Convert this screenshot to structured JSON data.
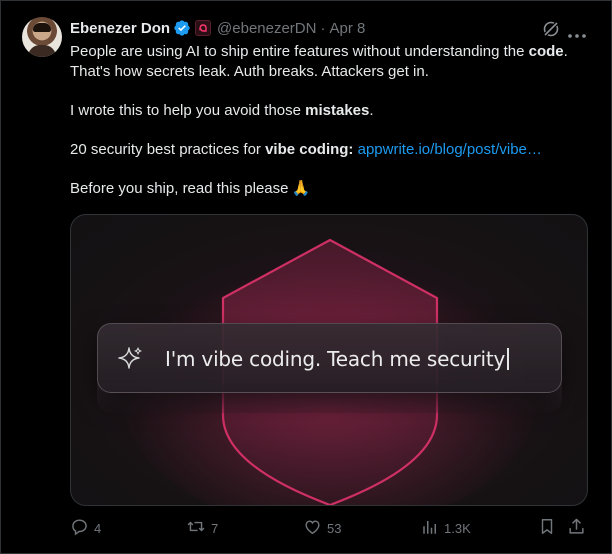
{
  "author": {
    "name": "Ebenezer Don",
    "handle": "@ebenezerDN",
    "separator": "·",
    "date": "Apr 8"
  },
  "tweet": {
    "line1_pre": "People are using AI to ship entire features without understanding the ",
    "line1_bold": "code",
    "line1_post": ".",
    "line2": "That's how secrets leak. Auth breaks. Attackers get in.",
    "line3_pre": "I wrote this to help you avoid those ",
    "line3_bold": "mistakes",
    "line3_post": ".",
    "line4_pre": "20 security best practices for ",
    "line4_bold": "vibe coding:",
    "line4_link": "appwrite.io/blog/post/vibe…",
    "line5": "Before you ship, read this please",
    "emoji": "🙏"
  },
  "media": {
    "prompt_text": "I'm vibe coding. Teach me security"
  },
  "actions": {
    "replies": "4",
    "reposts": "7",
    "likes": "53",
    "views": "1.3K"
  },
  "colors": {
    "background": "#000000",
    "text": "#e7e9ea",
    "muted": "#71767b",
    "link": "#1d9bf0",
    "verified": "#1d9bf0",
    "shield_accent": "#e0336b"
  },
  "icons": [
    "verified-badge-icon",
    "affiliate-badge-icon",
    "grok-icon",
    "more-icon",
    "sparkle-icon",
    "reply-icon",
    "repost-icon",
    "like-icon",
    "views-icon",
    "bookmark-icon",
    "share-icon"
  ]
}
